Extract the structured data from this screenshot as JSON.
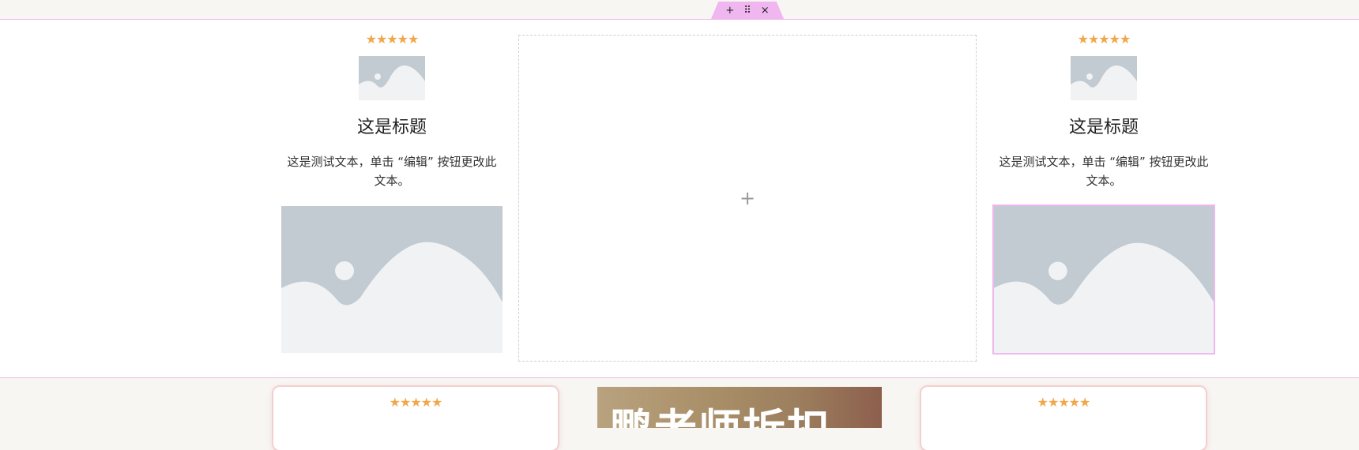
{
  "toolbar": {
    "add": "+",
    "move": "⠿",
    "close": "×"
  },
  "columns": [
    {
      "rating": "★★★★★",
      "title": "这是标题",
      "text": "这是测试文本，单击 “编辑” 按钮更改此文本。"
    },
    {
      "rating": "★★★★★",
      "title": "这是标题",
      "text": "这是测试文本，单击 “编辑” 按钮更改此文本。"
    }
  ],
  "empty_column": {
    "add": "+"
  },
  "bottom": {
    "card_left_rating": "★★★★★",
    "card_right_rating": "★★★★★",
    "banner_text": "鹏老师拆扣"
  },
  "colors": {
    "accent": "#f0b6ef",
    "star": "#f0a84b",
    "placeholder": "#c2cad2"
  }
}
